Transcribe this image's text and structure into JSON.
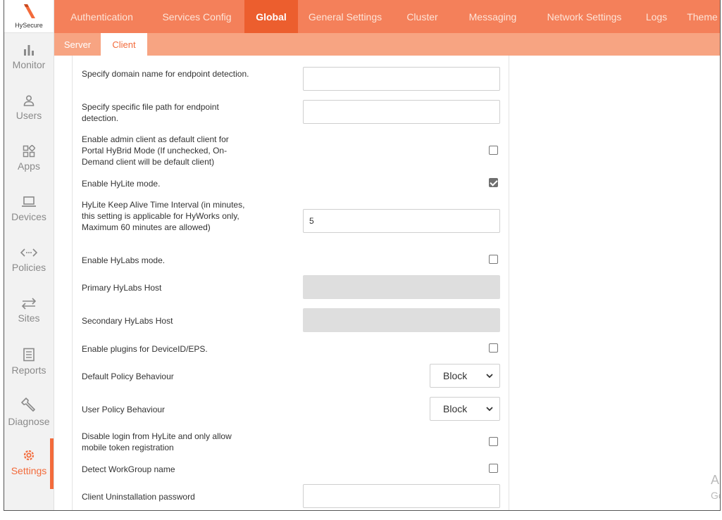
{
  "brand": {
    "name": "HySecure",
    "accent": "#f36b3b"
  },
  "sidebar": {
    "items": [
      {
        "label": "Monitor",
        "icon": "bar-chart-icon",
        "active": false
      },
      {
        "label": "Users",
        "icon": "user-icon",
        "active": false
      },
      {
        "label": "Apps",
        "icon": "apps-icon",
        "active": false
      },
      {
        "label": "Devices",
        "icon": "laptop-icon",
        "active": false
      },
      {
        "label": "Policies",
        "icon": "code-arrows-icon",
        "active": false
      },
      {
        "label": "Sites",
        "icon": "swap-arrows-icon",
        "active": false
      },
      {
        "label": "Reports",
        "icon": "document-icon",
        "active": false
      },
      {
        "label": "Diagnose",
        "icon": "wrench-icon",
        "active": false
      },
      {
        "label": "Settings",
        "icon": "gear-icon",
        "active": true
      }
    ]
  },
  "top_tabs": [
    "Authentication",
    "Services Config",
    "Global",
    "General Settings",
    "Cluster",
    "Messaging",
    "Network Settings",
    "Logs",
    "Theme"
  ],
  "active_top_tab": "Global",
  "sub_tabs": [
    "Server",
    "Client"
  ],
  "active_sub_tab": "Client",
  "form": {
    "domain_label": "Specify domain name for endpoint detection.",
    "domain_value": "",
    "filepath_label": "Specify specific file path for endpoint detection.",
    "filepath_value": "",
    "admin_client_label": "Enable admin client as default client for Portal HyBrid Mode (If unchecked, On-Demand client will be default client)",
    "admin_client_checked": false,
    "hylite_mode_label": "Enable HyLite mode.",
    "hylite_mode_checked": true,
    "keepalive_label": "HyLite Keep Alive Time Interval (in minutes, this setting is applicable for HyWorks only, Maximum 60 minutes are allowed)",
    "keepalive_value": "5",
    "hylabs_mode_label": "Enable HyLabs mode.",
    "hylabs_mode_checked": false,
    "primary_host_label": "Primary HyLabs Host",
    "primary_host_value": "",
    "secondary_host_label": "Secondary HyLabs Host",
    "secondary_host_value": "",
    "plugins_label": "Enable plugins for DeviceID/EPS.",
    "plugins_checked": false,
    "default_policy_label": "Default Policy Behaviour",
    "default_policy_value": "Block",
    "user_policy_label": "User Policy Behaviour",
    "user_policy_value": "Block",
    "disable_login_label": "Disable login from HyLite and only allow mobile token registration",
    "disable_login_checked": false,
    "workgroup_label": "Detect WorkGroup name",
    "workgroup_checked": false,
    "uninstall_pw_label": "Client Uninstallation password",
    "uninstall_pw_value": ""
  },
  "watermark": {
    "line1": "A",
    "line2": "Go"
  }
}
